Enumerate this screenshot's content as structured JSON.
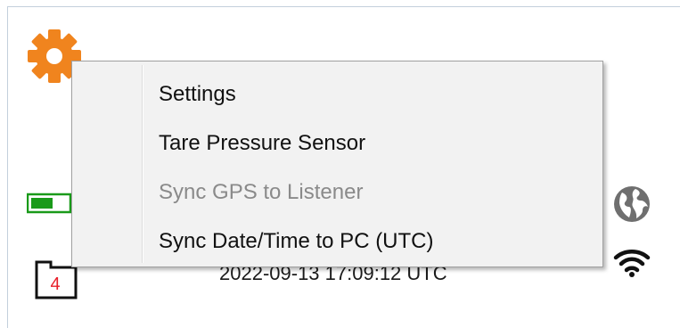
{
  "menu": {
    "items": [
      {
        "label": "Settings",
        "enabled": true
      },
      {
        "label": "Tare Pressure Sensor",
        "enabled": true
      },
      {
        "label": "Sync GPS to Listener",
        "enabled": false
      },
      {
        "label": "Sync Date/Time to PC (UTC)",
        "enabled": true
      }
    ]
  },
  "status": {
    "timestamp": "2022-09-13 17:09:12 UTC",
    "calendar_count": "4",
    "battery_color": "#1a9a1a"
  },
  "icons": {
    "settings": "gear-icon",
    "battery": "battery-icon",
    "calendar": "calendar-icon",
    "globe": "globe-icon",
    "wifi": "wifi-icon"
  },
  "colors": {
    "gear": "#f0841e",
    "calendar_count": "#e8202a",
    "globe": "#6f6f6f",
    "menu_background": "#f2f2f2",
    "disabled_text": "#8a8a8a"
  }
}
